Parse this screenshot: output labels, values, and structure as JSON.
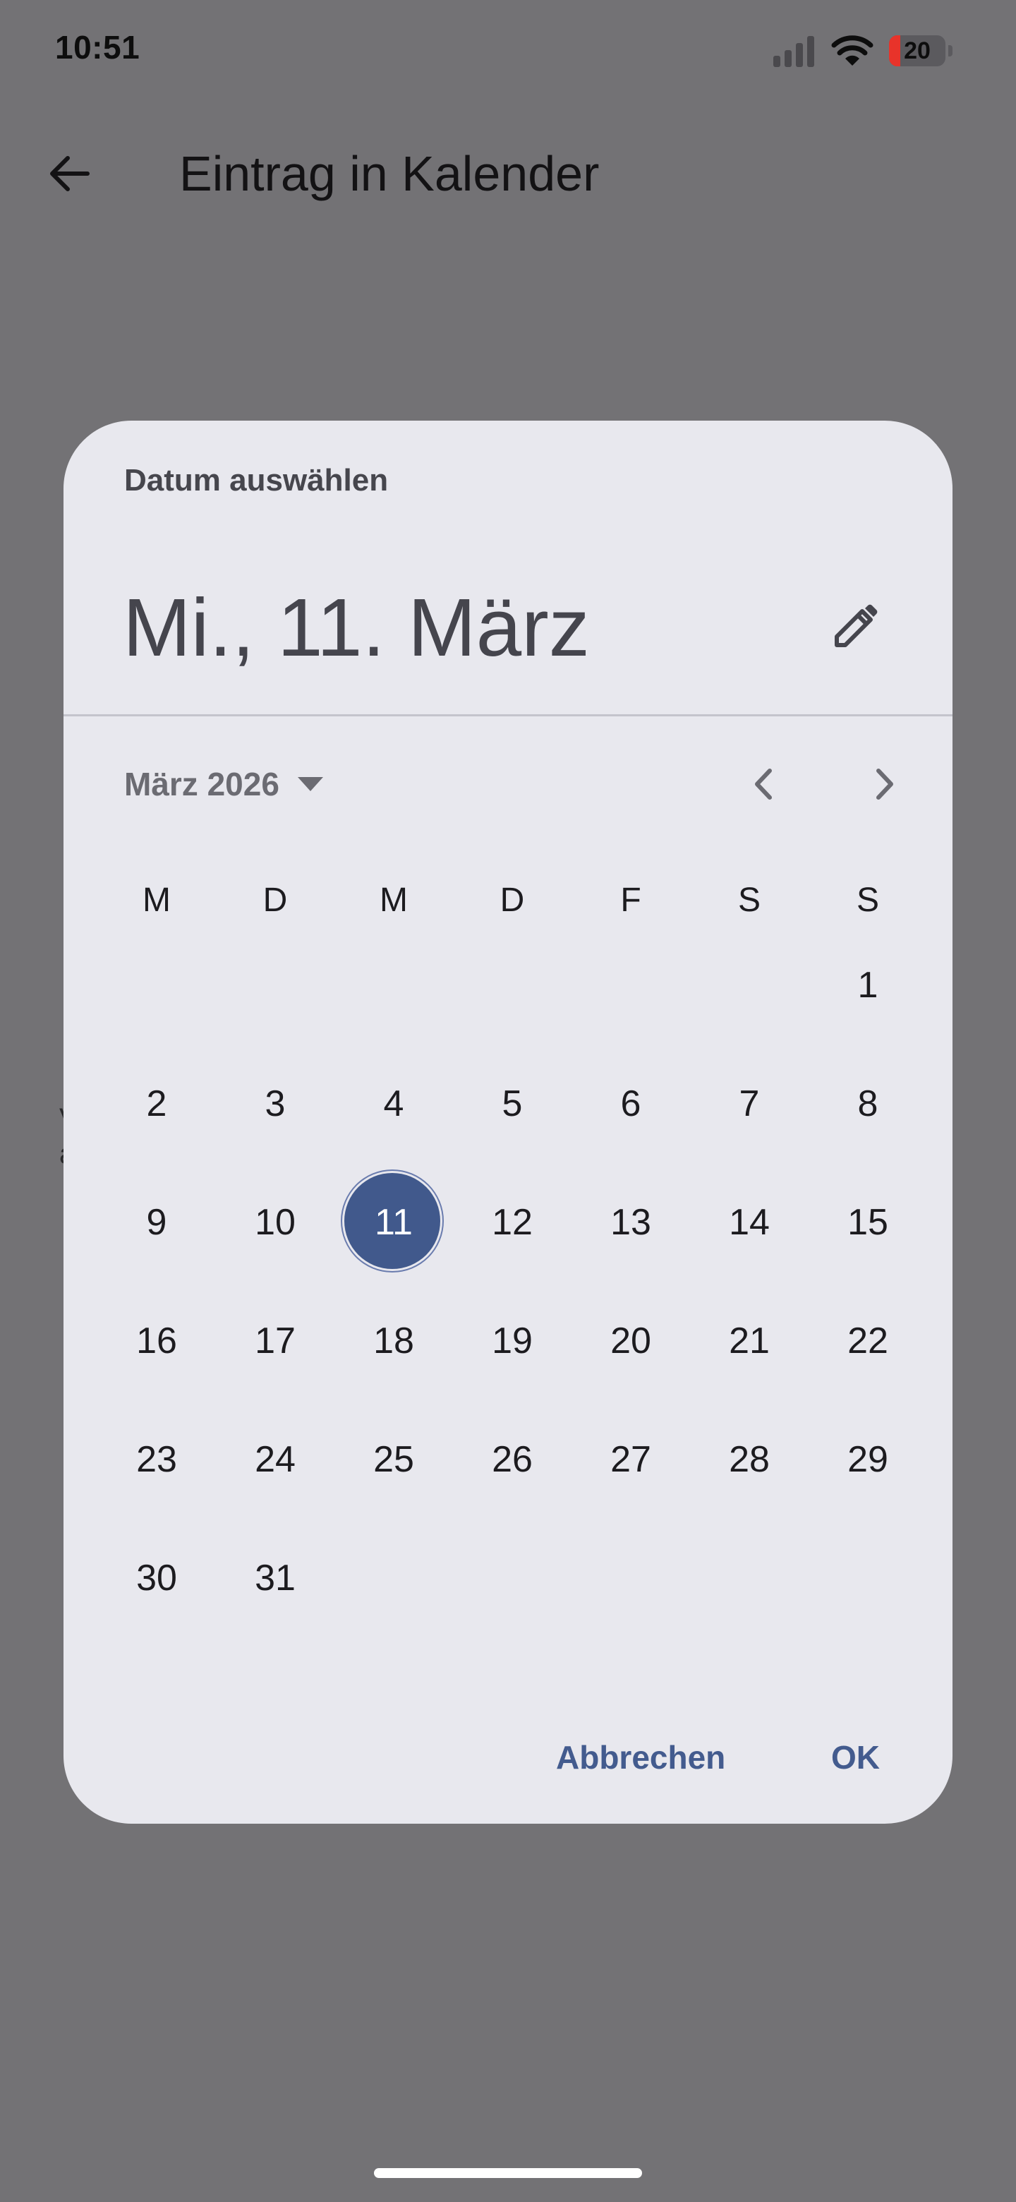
{
  "status_bar": {
    "time": "10:51",
    "battery_level": "20",
    "battery_fraction": 0.2,
    "signal_icon": "cellular-signal-icon",
    "wifi_icon": "wifi-icon",
    "battery_icon": "battery-low-icon"
  },
  "app_bar": {
    "title": "Eintrag in Kalender",
    "back_icon": "arrow-back-icon"
  },
  "background_fragment": {
    "line1": "V",
    "line2": "a"
  },
  "dialog": {
    "header_label": "Datum auswählen",
    "selected_date": "Mi., 11. März",
    "edit_icon": "pencil-icon",
    "month_label": "März 2026",
    "month_dropdown_icon": "triangle-down-icon",
    "prev_icon": "chevron-left-icon",
    "next_icon": "chevron-right-icon",
    "weekdays": [
      "M",
      "D",
      "M",
      "D",
      "F",
      "S",
      "S"
    ],
    "days": [
      "1",
      "2",
      "3",
      "4",
      "5",
      "6",
      "7",
      "8",
      "9",
      "10",
      "11",
      "12",
      "13",
      "14",
      "15",
      "16",
      "17",
      "18",
      "19",
      "20",
      "21",
      "22",
      "23",
      "24",
      "25",
      "26",
      "27",
      "28",
      "29",
      "30",
      "31"
    ],
    "first_weekday_index": 6,
    "selected_day": "11",
    "cancel_label": "Abbrechen",
    "ok_label": "OK"
  },
  "colors": {
    "scrim": "#737275",
    "dialog_surface": "#e8e8ee",
    "accent": "#41598c",
    "action_text": "#435b8e",
    "battery_low": "#e8332a"
  }
}
